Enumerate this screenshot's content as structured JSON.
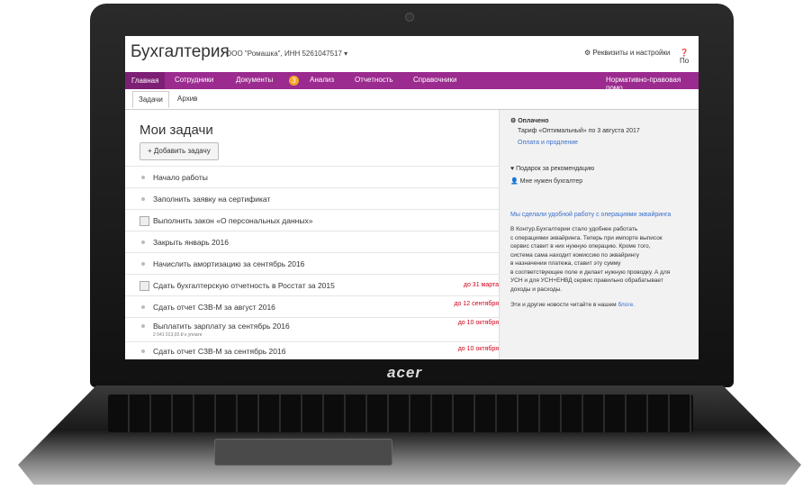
{
  "header": {
    "logo": "Бухгалтерия",
    "org": "ООО \"Ромашка\", ИНН 5261047517 ▾",
    "settings": "Реквизиты и настройки",
    "help": "По"
  },
  "nav": {
    "items": [
      "Главная",
      "Сотрудники",
      "Документы",
      "Анализ",
      "Отчетность",
      "Справочники"
    ],
    "badge": "3",
    "right": "Нормативно-правовая помо"
  },
  "subtabs": [
    "Задачи",
    "Архив"
  ],
  "main": {
    "title": "Мои задачи",
    "add_button": "+ Добавить задачу"
  },
  "tasks": [
    {
      "text": "Начало работы",
      "deadline": "",
      "sub": "",
      "checkbox": false
    },
    {
      "text": "Заполнить заявку на сертификат",
      "deadline": "",
      "sub": "",
      "checkbox": false
    },
    {
      "text": "Выполнить закон «О персональных данных»",
      "deadline": "",
      "sub": "",
      "checkbox": true
    },
    {
      "text": "Закрыть январь 2016",
      "deadline": "",
      "sub": "",
      "checkbox": false
    },
    {
      "text": "Начислить амортизацию за сентябрь 2016",
      "deadline": "",
      "sub": "",
      "checkbox": false
    },
    {
      "text": "Сдать бухгалтерскую отчетность в Росстат за 2015",
      "deadline": "до 31 марта",
      "sub": "",
      "checkbox": true
    },
    {
      "text": "Сдать отчет СЗВ-М за август 2016",
      "deadline": "до 12 сентября",
      "sub": "",
      "checkbox": false
    },
    {
      "text": "Выплатить зарплату за сентябрь 2016",
      "deadline": "до 10 октября",
      "sub": "2 041 013,03 ₽ к уплате",
      "checkbox": false
    },
    {
      "text": "Сдать отчет СЗВ-М за сентябрь 2016",
      "deadline": "до 10 октября",
      "sub": "",
      "checkbox": false
    }
  ],
  "sidebar": {
    "paid": "Оплачено",
    "tariff": "Тариф «Оптимальный» по 3 августа 2017",
    "pay_link": "Оплата и продление",
    "gift": "Подарок за рекомендацию",
    "need_accountant": "Мне нужен бухгалтер",
    "news_title": "Мы сделали удобной работу с операциями эквайринга",
    "news_lines": [
      "В Контур.Бухгалтерии стало удобнее работать",
      "с операциями эквайринга. Теперь при импорте выписок",
      "сервис ставит в них нужную операцию. Кроме того,",
      "система сама находит комиссию по эквайрингу",
      "в назначении платежа, ставит эту сумму",
      "в соответствующее поле и делает нужную проводку. А для",
      "УСН и для УСН+ЕНВД сервис правильно обрабатывает",
      "доходы и расходы."
    ],
    "news_more": "Эти и другие новости читайте в нашем",
    "blog_link": "блоге."
  },
  "laptop": {
    "brand": "acer"
  }
}
